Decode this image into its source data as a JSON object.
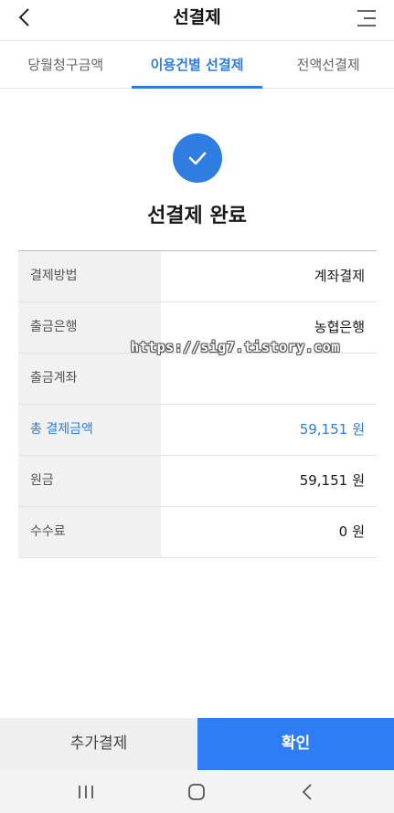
{
  "header": {
    "title": "선결제"
  },
  "tabs": [
    {
      "label": "당월청구금액",
      "active": false
    },
    {
      "label": "이용건별 선결제",
      "active": true
    },
    {
      "label": "전액선결제",
      "active": false
    }
  ],
  "status": {
    "title": "선결제 완료",
    "icon": "check-icon"
  },
  "details": [
    {
      "label": "결제방법",
      "value": "계좌결제",
      "unit": ""
    },
    {
      "label": "출금은행",
      "value": "농협은행",
      "unit": ""
    },
    {
      "label": "출금계좌",
      "value": "",
      "unit": ""
    },
    {
      "label": "총 결제금액",
      "value": "59,151",
      "unit": "원"
    },
    {
      "label": "원금",
      "value": "59,151",
      "unit": "원"
    },
    {
      "label": "수수료",
      "value": "0",
      "unit": "원"
    }
  ],
  "watermark": "https://sig7.tistory.com",
  "buttons": {
    "secondary": "추가결제",
    "primary": "확인"
  },
  "colors": {
    "accent": "#2f7de0",
    "primary_button": "#2f7df5"
  }
}
